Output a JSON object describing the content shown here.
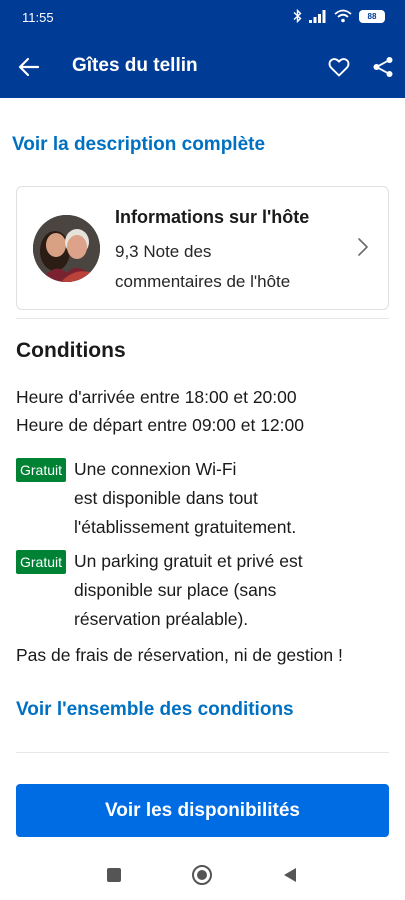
{
  "status_bar": {
    "time": "11:55",
    "battery": "88"
  },
  "app_bar": {
    "title": "Gîtes du tellin"
  },
  "description_link": "Voir la description complète",
  "host": {
    "title": "Informations sur l'hôte",
    "rating_line1": "9,3 Note des",
    "rating_line2": "commentaires de l'hôte"
  },
  "conditions": {
    "title": "Conditions",
    "checkin": "Heure d'arrivée entre 18:00 et 20:00",
    "checkout": "Heure de départ entre 09:00 et 12:00",
    "amenities": [
      {
        "badge": "Gratuit",
        "lines": [
          "Une connexion Wi-Fi",
          "est disponible dans tout",
          "l'établissement gratuitement."
        ]
      },
      {
        "badge": "Gratuit",
        "lines": [
          "Un parking gratuit et privé est",
          "disponible sur place (sans",
          "réservation préalable)."
        ]
      }
    ],
    "fees_note": "Pas de frais de réservation, ni de gestion !",
    "all_conditions_link": "Voir l'ensemble des conditions"
  },
  "cta_label": "Voir les disponibilités",
  "colors": {
    "brand": "#003b95",
    "link": "#0071c2",
    "cta": "#006ce4",
    "badge": "#008234"
  },
  "icons": [
    "back-arrow-icon",
    "heart-icon",
    "share-icon",
    "chevron-right-icon",
    "bluetooth-icon",
    "signal-icon",
    "wifi-icon",
    "battery-icon",
    "nav-recents-icon",
    "nav-home-icon",
    "nav-back-icon"
  ]
}
